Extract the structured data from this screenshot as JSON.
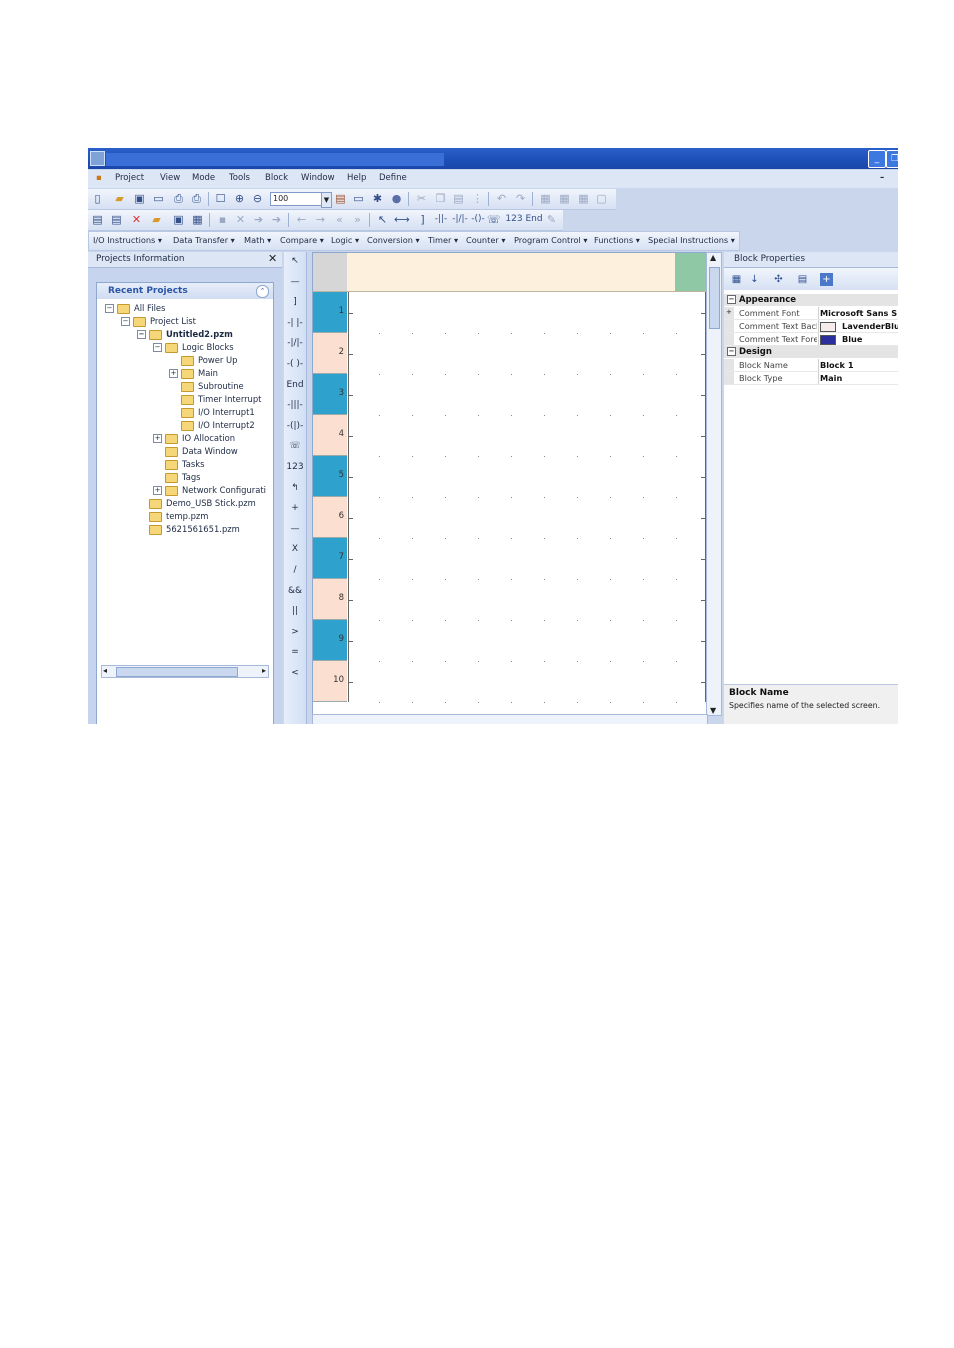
{
  "menubar": [
    "Project",
    "View",
    "Mode",
    "Tools",
    "Block",
    "Window",
    "Help",
    "Define"
  ],
  "toolbar": {
    "zoom_value": "100"
  },
  "ladder_tools": [
    "↖",
    "—",
    "]",
    "-| |-",
    "-|/|-",
    "-( )-",
    "End",
    "-|||-",
    "-(|)-",
    "☏",
    "123",
    "↰",
    "+",
    "—",
    "X",
    "/",
    "&&",
    "||",
    ">",
    "=",
    "<"
  ],
  "instruction_menus": [
    "I/O Instructions",
    "Data Transfer",
    "Math",
    "Compare",
    "Logic",
    "Conversion",
    "Timer",
    "Counter",
    "Program Control",
    "Functions",
    "Special Instructions"
  ],
  "projects_panel": {
    "title": "Projects Information",
    "recent_title": "Recent Projects",
    "tree": [
      {
        "label": "All Files",
        "level": 0,
        "toggle": "−",
        "bold": false
      },
      {
        "label": "Project List",
        "level": 1,
        "toggle": "−",
        "bold": false
      },
      {
        "label": "Untitled2.pzm",
        "level": 2,
        "toggle": "−",
        "bold": true
      },
      {
        "label": "Logic Blocks",
        "level": 3,
        "toggle": "−",
        "bold": false
      },
      {
        "label": "Power Up",
        "level": 4,
        "toggle": "",
        "bold": false
      },
      {
        "label": "Main",
        "level": 4,
        "toggle": "+",
        "bold": false
      },
      {
        "label": "Subroutine",
        "level": 4,
        "toggle": "",
        "bold": false
      },
      {
        "label": "Timer Interrupt",
        "level": 4,
        "toggle": "",
        "bold": false
      },
      {
        "label": "I/O Interrupt1",
        "level": 4,
        "toggle": "",
        "bold": false
      },
      {
        "label": "I/O Interrupt2",
        "level": 4,
        "toggle": "",
        "bold": false
      },
      {
        "label": "IO Allocation",
        "level": 3,
        "toggle": "+",
        "bold": false
      },
      {
        "label": "Data Window",
        "level": 3,
        "toggle": "",
        "bold": false
      },
      {
        "label": "Tasks",
        "level": 3,
        "toggle": "",
        "bold": false
      },
      {
        "label": "Tags",
        "level": 3,
        "toggle": "",
        "bold": false
      },
      {
        "label": "Network Configurati",
        "level": 3,
        "toggle": "+",
        "bold": false
      },
      {
        "label": "Demo_USB Stick.pzm",
        "level": 2,
        "toggle": "",
        "bold": false
      },
      {
        "label": "temp.pzm",
        "level": 2,
        "toggle": "",
        "bold": false
      },
      {
        "label": "5621561651.pzm",
        "level": 2,
        "toggle": "",
        "bold": false
      }
    ]
  },
  "ladder": {
    "rungs": [
      "1",
      "2",
      "3",
      "4",
      "5",
      "6",
      "7",
      "8",
      "9",
      "10"
    ]
  },
  "properties": {
    "title": "Block Properties",
    "categories": {
      "appearance": "Appearance",
      "design": "Design"
    },
    "rows": {
      "comment_font": {
        "name": "Comment Font",
        "value": "Microsoft Sans S"
      },
      "comment_back": {
        "name": "Comment Text Back",
        "value": "LavenderBlu",
        "color": "#f6ecec"
      },
      "comment_fore": {
        "name": "Comment Text Fore",
        "value": "Blue",
        "color": "#2b2f9e"
      },
      "block_name": {
        "name": "Block Name",
        "value": "Block 1"
      },
      "block_type": {
        "name": "Block Type",
        "value": "Main"
      }
    },
    "description_title": "Block Name",
    "description_text": "Specifies name of the selected screen."
  }
}
